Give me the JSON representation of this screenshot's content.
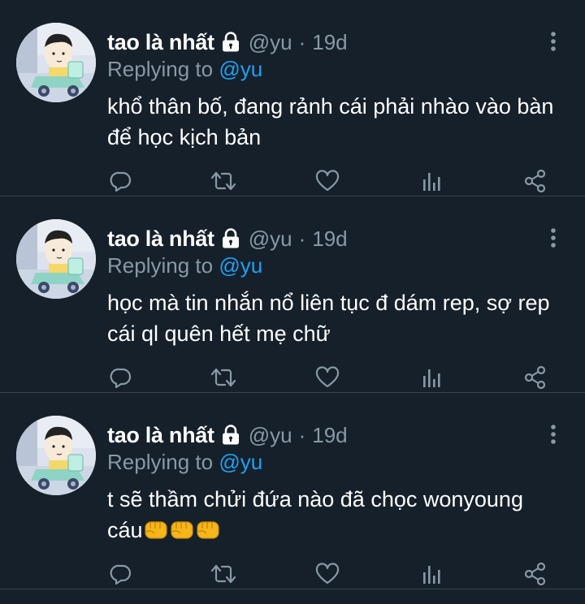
{
  "tweets": [
    {
      "name": "tao là nhất",
      "handle": "@yu",
      "separator": "·",
      "time": "19d",
      "replying_prefix": "Replying to",
      "replying_handle": "@yu",
      "text": "khổ thân bố, đang rảnh cái phải nhào vào bàn để học kịch bản",
      "emojis": []
    },
    {
      "name": "tao là nhất",
      "handle": "@yu",
      "separator": "·",
      "time": "19d",
      "replying_prefix": "Replying to",
      "replying_handle": "@yu",
      "text": "học mà tin nhắn nổ liên tục đ dám rep, sợ rep cái ql quên hết mẹ chữ",
      "emojis": []
    },
    {
      "name": "tao là nhất",
      "handle": "@yu",
      "separator": "·",
      "time": "19d",
      "replying_prefix": "Replying to",
      "replying_handle": "@yu",
      "text": "t sẽ thầm chửi đứa nào đã chọc wonyoung cáu",
      "emojis": [
        "oncoming-fist",
        "oncoming-fist",
        "oncoming-fist"
      ]
    }
  ],
  "icons": {
    "lock": "lock-icon",
    "more": "more-vertical-icon",
    "reply": "reply-icon",
    "retweet": "retweet-icon",
    "like": "heart-icon",
    "analytics": "analytics-icon",
    "share": "share-icon",
    "emoji": "oncoming-fist"
  },
  "colors": {
    "background": "#15202b",
    "text": "#ffffff",
    "secondary": "#8899a6",
    "accent": "#1da1f2",
    "divider": "#38444d"
  }
}
